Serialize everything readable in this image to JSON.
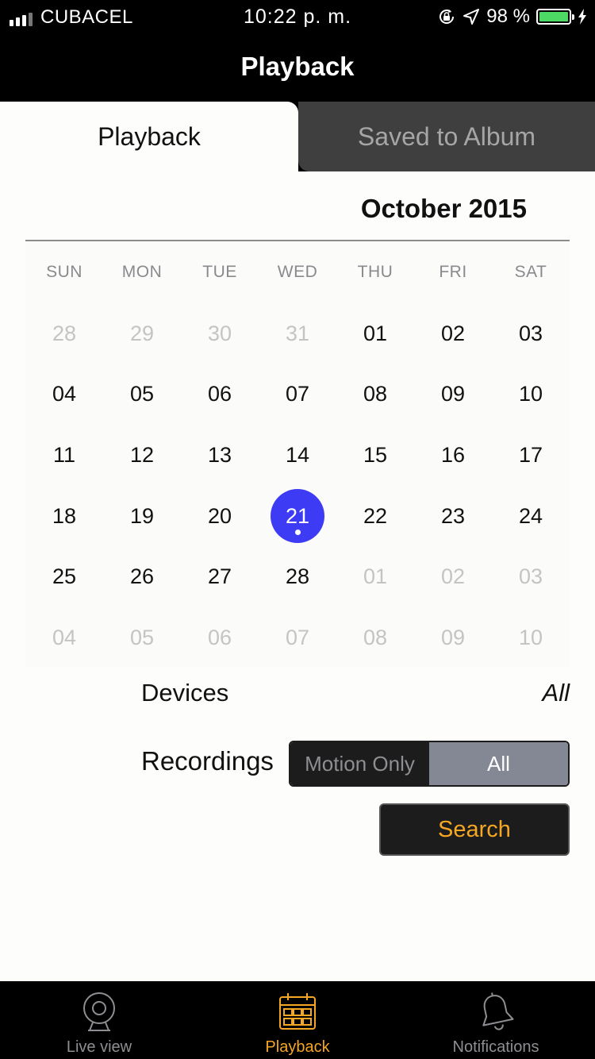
{
  "status_bar": {
    "carrier": "CUBACEL",
    "time": "10:22 p. m.",
    "battery": "98 %",
    "battery_color": "#4cd964"
  },
  "nav": {
    "title": "Playback"
  },
  "segments": {
    "playback": "Playback",
    "saved": "Saved to Album"
  },
  "calendar": {
    "month": "October 2015",
    "weekdays": [
      "SUN",
      "MON",
      "TUE",
      "WED",
      "THU",
      "FRI",
      "SAT"
    ],
    "selected_day": "21",
    "selected_color": "#3e3bf5",
    "weeks": [
      [
        "28",
        "29",
        "30",
        "31",
        "01",
        "02",
        "03"
      ],
      [
        "04",
        "05",
        "06",
        "07",
        "08",
        "09",
        "10"
      ],
      [
        "11",
        "12",
        "13",
        "14",
        "15",
        "16",
        "17"
      ],
      [
        "18",
        "19",
        "20",
        "21",
        "22",
        "23",
        "24"
      ],
      [
        "25",
        "26",
        "27",
        "28",
        "01",
        "02",
        "03"
      ],
      [
        "04",
        "05",
        "06",
        "07",
        "08",
        "09",
        "10"
      ]
    ]
  },
  "devices": {
    "label": "Devices",
    "value": "All"
  },
  "recordings": {
    "label": "Recordings",
    "options": [
      "Motion Only",
      "All"
    ],
    "selected": "All"
  },
  "search": {
    "label": "Search",
    "color": "#f5a623"
  },
  "tab_bar": {
    "items": [
      {
        "label": "Live view",
        "icon": "webcam-icon"
      },
      {
        "label": "Playback",
        "icon": "calendar-icon"
      },
      {
        "label": "Notifications",
        "icon": "bell-icon"
      }
    ],
    "active": "Playback"
  }
}
